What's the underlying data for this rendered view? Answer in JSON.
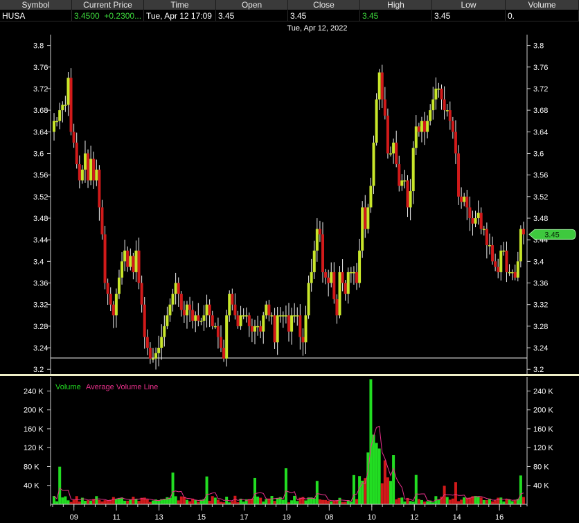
{
  "quote_table": {
    "headers": [
      "Symbol",
      "Current Price",
      "Time",
      "Open",
      "Close",
      "High",
      "Low",
      "Volume"
    ],
    "symbol": "HUSA",
    "current_price": "3.4500",
    "change": "+0.2300...",
    "time": "Tue, Apr 12  17:09",
    "open": "3.45",
    "close": "3.45",
    "high": "3.45",
    "low": "3.45",
    "volume": "0."
  },
  "chart_data": [
    {
      "type": "candlestick",
      "title": "Tue, Apr 12, 2022",
      "y_ticks": [
        "3.8",
        "3.76",
        "3.72",
        "3.68",
        "3.64",
        "3.6",
        "3.56",
        "3.52",
        "3.48",
        "3.44",
        "3.4",
        "3.36",
        "3.32",
        "3.28",
        "3.24",
        "3.2"
      ],
      "ylim": [
        3.19,
        3.82
      ],
      "reference_line": 3.221,
      "last_price_label": "3.45",
      "last_price": 3.45,
      "x_ticks": [
        "09",
        "11",
        "13",
        "15",
        "17",
        "19",
        "08",
        "10",
        "12",
        "14",
        "16"
      ],
      "x_tick_positions": [
        1.0,
        3.0,
        5.0,
        7.0,
        9.0,
        11.0,
        13.0,
        15.0,
        17.0,
        19.0,
        21.0
      ],
      "xlim": [
        0,
        22.2
      ],
      "up_color": "#c8e62a",
      "down_color": "#d11a1a",
      "closes": [
        3.66,
        3.66,
        3.68,
        3.69,
        3.69,
        3.74,
        3.64,
        3.62,
        3.58,
        3.55,
        3.57,
        3.6,
        3.55,
        3.59,
        3.55,
        3.57,
        3.5,
        3.45,
        3.36,
        3.34,
        3.32,
        3.3,
        3.34,
        3.37,
        3.4,
        3.42,
        3.39,
        3.41,
        3.38,
        3.42,
        3.36,
        3.32,
        3.26,
        3.24,
        3.22,
        3.22,
        3.23,
        3.24,
        3.26,
        3.28,
        3.3,
        3.32,
        3.34,
        3.36,
        3.34,
        3.31,
        3.3,
        3.32,
        3.31,
        3.29,
        3.3,
        3.29,
        3.29,
        3.3,
        3.32,
        3.3,
        3.28,
        3.28,
        3.26,
        3.24,
        3.22,
        3.3,
        3.34,
        3.32,
        3.3,
        3.28,
        3.3,
        3.3,
        3.3,
        3.28,
        3.27,
        3.28,
        3.28,
        3.27,
        3.3,
        3.32,
        3.3,
        3.3,
        3.25,
        3.3,
        3.3,
        3.3,
        3.3,
        3.27,
        3.3,
        3.3,
        3.3,
        3.26,
        3.25,
        3.3,
        3.36,
        3.38,
        3.42,
        3.46,
        3.45,
        3.38,
        3.37,
        3.36,
        3.38,
        3.33,
        3.3,
        3.38,
        3.36,
        3.34,
        3.38,
        3.38,
        3.38,
        3.36,
        3.42,
        3.5,
        3.46,
        3.5,
        3.54,
        3.62,
        3.7,
        3.75,
        3.7,
        3.67,
        3.6,
        3.6,
        3.62,
        3.58,
        3.54,
        3.55,
        3.55,
        3.5,
        3.53,
        3.61,
        3.65,
        3.64,
        3.66,
        3.64,
        3.66,
        3.68,
        3.7,
        3.72,
        3.72,
        3.7,
        3.68,
        3.68,
        3.66,
        3.64,
        3.6,
        3.52,
        3.51,
        3.52,
        3.5,
        3.48,
        3.47,
        3.48,
        3.49,
        3.46,
        3.46,
        3.43,
        3.43,
        3.4,
        3.39,
        3.38,
        3.42,
        3.42,
        3.38,
        3.38,
        3.38,
        3.37,
        3.4,
        3.46,
        3.45
      ],
      "volume_chart": {
        "legend": [
          "Volume",
          "Average Volume Line"
        ],
        "legend_colors": [
          "#22dd22",
          "#e8308a"
        ],
        "y_ticks": [
          "240 K",
          "200 K",
          "160 K",
          "120 K",
          "80 K",
          "40 K"
        ],
        "ylim": [
          0,
          270000
        ],
        "up_color": "#22dd22",
        "down_color": "#d11a1a",
        "avg_color": "#e8308a"
      }
    }
  ]
}
